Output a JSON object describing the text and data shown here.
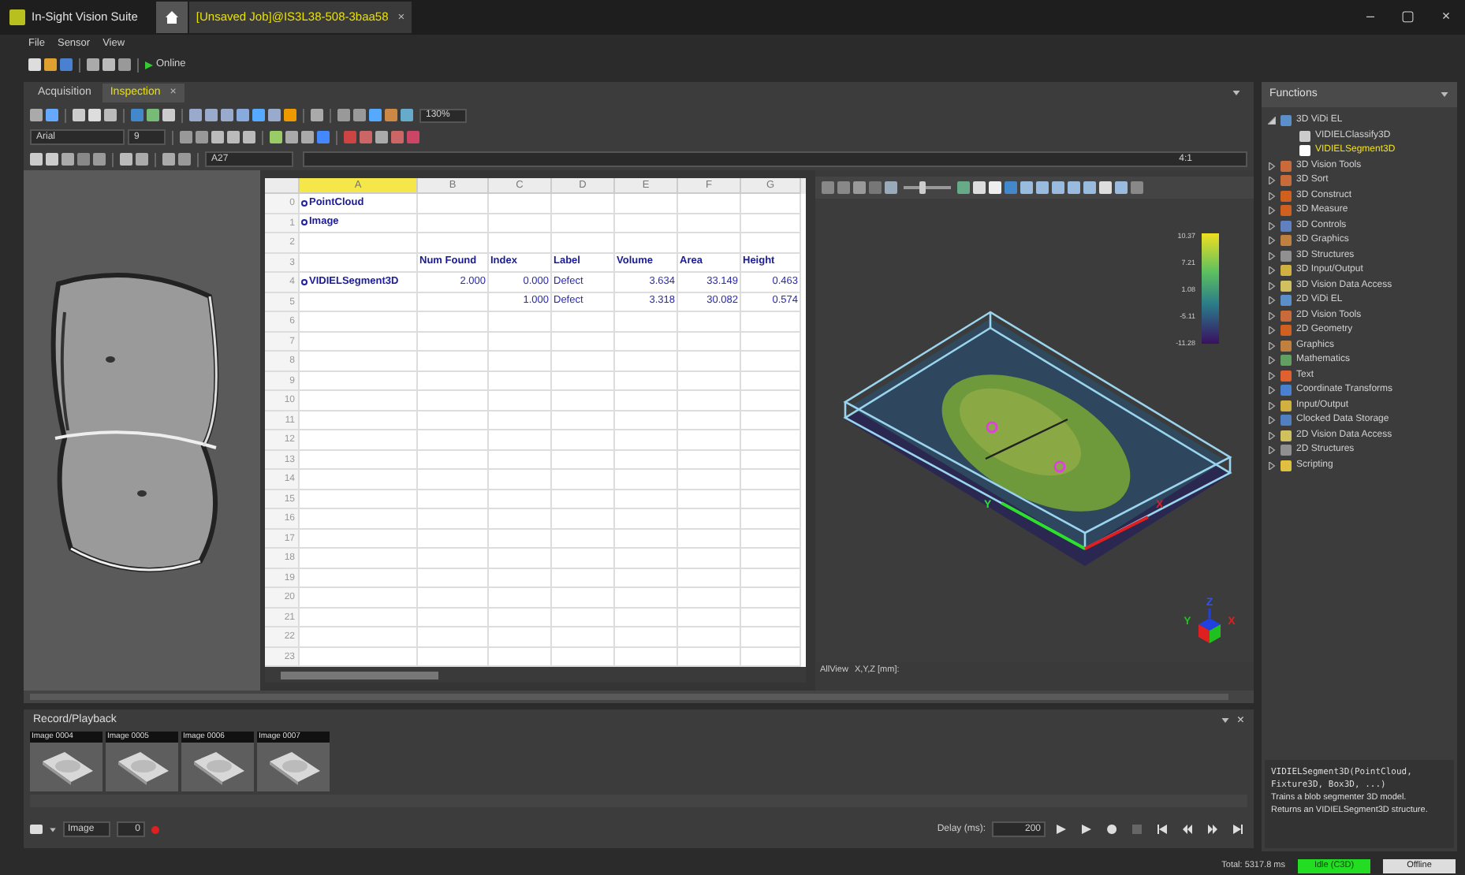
{
  "window": {
    "app_title": "In-Sight Vision Suite",
    "job_tab": "[Unsaved Job]@IS3L38-508-3baa58",
    "tab_close": "×",
    "controls": [
      "–",
      "▢",
      "×"
    ]
  },
  "menu": [
    "File",
    "Sensor",
    "View"
  ],
  "toolbar": {
    "online_label": "Online"
  },
  "dock_tabs": [
    {
      "label": "Acquisition",
      "selected": false
    },
    {
      "label": "Inspection",
      "selected": true,
      "close": "×"
    }
  ],
  "format_toolbar": {
    "zoom": "130%",
    "font": "Arial",
    "font_size": "9",
    "cell_ref": "A27",
    "cell_hint": "4:1"
  },
  "spreadsheet": {
    "columns": [
      {
        "label": "A",
        "selected": true
      },
      {
        "label": "B",
        "selected": false
      },
      {
        "label": "C",
        "selected": false
      },
      {
        "label": "D",
        "selected": false
      },
      {
        "label": "E",
        "selected": false
      },
      {
        "label": "F",
        "selected": false
      },
      {
        "label": "G",
        "selected": false
      }
    ],
    "rows": [
      {
        "number": "0",
        "cells": [
          {
            "kind": "ref",
            "text": "PointCloud"
          },
          {
            "kind": "empty"
          },
          {
            "kind": "empty"
          },
          {
            "kind": "empty"
          },
          {
            "kind": "empty"
          },
          {
            "kind": "empty"
          },
          {
            "kind": "empty"
          }
        ]
      },
      {
        "number": "1",
        "cells": [
          {
            "kind": "ref",
            "text": "Image"
          },
          {
            "kind": "empty"
          },
          {
            "kind": "empty"
          },
          {
            "kind": "empty"
          },
          {
            "kind": "empty"
          },
          {
            "kind": "empty"
          },
          {
            "kind": "empty"
          }
        ]
      },
      {
        "number": "2"
      },
      {
        "number": "3",
        "cells": [
          {
            "kind": "empty"
          },
          {
            "kind": "heading",
            "text": "Num Found"
          },
          {
            "kind": "heading",
            "text": "Index"
          },
          {
            "kind": "heading",
            "text": "Label"
          },
          {
            "kind": "heading",
            "text": "Volume"
          },
          {
            "kind": "heading",
            "text": "Area"
          },
          {
            "kind": "heading",
            "text": "Height"
          }
        ]
      },
      {
        "number": "4",
        "cells": [
          {
            "kind": "ref",
            "text": "VIDIELSegment3D"
          },
          {
            "kind": "number",
            "text": "2.000"
          },
          {
            "kind": "number",
            "text": "0.000"
          },
          {
            "kind": "text",
            "text": "Defect"
          },
          {
            "kind": "number",
            "text": "3.634"
          },
          {
            "kind": "number",
            "text": "33.149"
          },
          {
            "kind": "number",
            "text": "0.463"
          }
        ]
      },
      {
        "number": "5",
        "cells": [
          {
            "kind": "empty"
          },
          {
            "kind": "empty"
          },
          {
            "kind": "number",
            "text": "1.000"
          },
          {
            "kind": "text",
            "text": "Defect"
          },
          {
            "kind": "number",
            "text": "3.318"
          },
          {
            "kind": "number",
            "text": "30.082"
          },
          {
            "kind": "number",
            "text": "0.574"
          }
        ]
      },
      {
        "number": "6"
      },
      {
        "number": "7"
      },
      {
        "number": "8"
      },
      {
        "number": "9"
      },
      {
        "number": "10"
      },
      {
        "number": "11"
      },
      {
        "number": "12"
      },
      {
        "number": "13"
      },
      {
        "number": "14"
      },
      {
        "number": "15"
      },
      {
        "number": "16"
      },
      {
        "number": "17"
      },
      {
        "number": "18"
      },
      {
        "number": "19"
      },
      {
        "number": "20"
      },
      {
        "number": "21"
      },
      {
        "number": "22"
      },
      {
        "number": "23"
      }
    ]
  },
  "view3d": {
    "zoom_slider": {
      "level": 0.4
    },
    "colorbar_ticks": [
      "10.37",
      "7.21",
      "1.08",
      "-5.11",
      "-11.28"
    ],
    "axis_labels": {
      "x": "X",
      "y": "Y"
    },
    "triad": {
      "x": "X",
      "y": "Y",
      "z": "Z"
    },
    "status": [
      "AllView",
      "X,Y,Z [mm]:"
    ]
  },
  "record_playback": {
    "title": "Record/Playback",
    "close": "×",
    "thumbnails": [
      "Image 0004",
      "Image 0005",
      "Image 0006",
      "Image 0007"
    ],
    "source": "Image",
    "frame": "0",
    "delay_label": "Delay (ms):",
    "delay": "200"
  },
  "functions": {
    "title": "Functions",
    "items": [
      {
        "label": "3D ViDi EL",
        "color": "#5b8fc9",
        "expanded": true,
        "selected": false,
        "children": [
          {
            "label": "VIDIELClassify3D",
            "color": "#cccccc",
            "selected": false
          },
          {
            "label": "VIDIELSegment3D",
            "color": "#ffffff",
            "selected": true
          }
        ]
      },
      {
        "label": "3D Vision Tools",
        "color": "#c86a3a",
        "expanded": false,
        "selected": false
      },
      {
        "label": "3D Sort",
        "color": "#c86a3a",
        "expanded": false,
        "selected": false
      },
      {
        "label": "3D Construct",
        "color": "#d06020",
        "expanded": false,
        "selected": false
      },
      {
        "label": "3D Measure",
        "color": "#d06020",
        "expanded": false,
        "selected": false
      },
      {
        "label": "3D Controls",
        "color": "#6080c0",
        "expanded": false,
        "selected": false
      },
      {
        "label": "3D Graphics",
        "color": "#c08040",
        "expanded": false,
        "selected": false
      },
      {
        "label": "3D Structures",
        "color": "#909090",
        "expanded": false,
        "selected": false
      },
      {
        "label": "3D Input/Output",
        "color": "#d0b040",
        "expanded": false,
        "selected": false
      },
      {
        "label": "3D Vision Data Access",
        "color": "#d0c060",
        "expanded": false,
        "selected": false
      },
      {
        "label": "2D ViDi EL",
        "color": "#5b8fc9",
        "expanded": false,
        "selected": false
      },
      {
        "label": "2D Vision Tools",
        "color": "#c86a3a",
        "expanded": false,
        "selected": false
      },
      {
        "label": "2D Geometry",
        "color": "#d06020",
        "expanded": false,
        "selected": false
      },
      {
        "label": "Graphics",
        "color": "#c08040",
        "expanded": false,
        "selected": false
      },
      {
        "label": "Mathematics",
        "color": "#60a060",
        "expanded": false,
        "selected": false
      },
      {
        "label": "Text",
        "color": "#e06030",
        "expanded": false,
        "selected": false
      },
      {
        "label": "Coordinate Transforms",
        "color": "#4a80d0",
        "expanded": false,
        "selected": false
      },
      {
        "label": "Input/Output",
        "color": "#d0b040",
        "expanded": false,
        "selected": false
      },
      {
        "label": "Clocked Data Storage",
        "color": "#5080c0",
        "expanded": false,
        "selected": false
      },
      {
        "label": "2D Vision Data Access",
        "color": "#d0c060",
        "expanded": false,
        "selected": false
      },
      {
        "label": "2D Structures",
        "color": "#909090",
        "expanded": false,
        "selected": false
      },
      {
        "label": "Scripting",
        "color": "#e0c040",
        "expanded": false,
        "selected": false
      }
    ],
    "description": [
      "VIDIELSegment3D(PointCloud,",
      "Fixture3D, Box3D, ...)",
      "Trains a blob segmenter 3D model.",
      "Returns an VIDIELSegment3D structure."
    ]
  },
  "status_bar": {
    "total": "Total: 5317.8 ms",
    "state": "Idle (C3D)",
    "mode": "Offline"
  }
}
